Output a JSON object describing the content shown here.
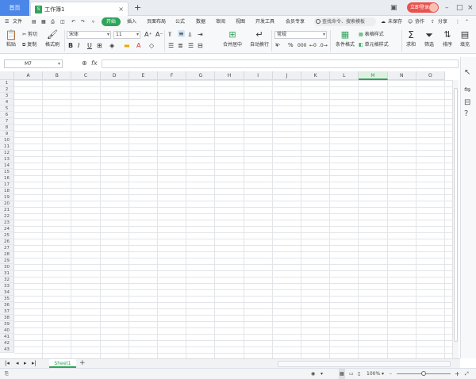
{
  "titlebar": {
    "home_tab": "首页",
    "doc_tab": "工作簿1",
    "doc_icon": "S",
    "close": "×",
    "new_tab": "+",
    "login": "立即登录"
  },
  "menu": {
    "file": "文件",
    "items": [
      "开始",
      "插入",
      "页面布局",
      "公式",
      "数据",
      "审阅",
      "视图",
      "开发工具",
      "会员专享"
    ],
    "active": "开始",
    "search_placeholder": "查找命令、搜索模板",
    "unsaved": "未保存",
    "collab": "协作",
    "share": "分享"
  },
  "ribbon": {
    "paste": "粘贴",
    "cut": "剪切",
    "copy": "复制",
    "format_painter": "格式刷",
    "font": "宋体",
    "size": "11",
    "merge": "合并居中",
    "wrap": "自动换行",
    "number_format": "常规",
    "cond_format": "条件格式",
    "table_style": "表格样式",
    "cell_style": "单元格样式",
    "sum": "求和",
    "filter": "筛选",
    "sort": "排序",
    "fill": "填充"
  },
  "formula": {
    "namebox": "M7",
    "fx": "fx"
  },
  "grid": {
    "columns": [
      "A",
      "B",
      "C",
      "D",
      "E",
      "F",
      "G",
      "H",
      "I",
      "J",
      "K",
      "L",
      "M",
      "N",
      "O"
    ],
    "selected_column": "M",
    "rows": [
      "1",
      "2",
      "3",
      "4",
      "5",
      "6",
      "7",
      "8",
      "9",
      "10",
      "11",
      "12",
      "13",
      "14",
      "15",
      "16",
      "17",
      "18",
      "19",
      "20",
      "21",
      "22",
      "23",
      "24",
      "25",
      "26",
      "27",
      "28",
      "29",
      "30",
      "31",
      "32",
      "33",
      "34",
      "35",
      "36",
      "37",
      "38",
      "39",
      "40",
      "41",
      "42",
      "43"
    ]
  },
  "sheets": {
    "tabs": [
      "Sheet1"
    ],
    "add": "+"
  },
  "status": {
    "zoom": "100%",
    "zoom_minus": "–",
    "zoom_plus": "+"
  },
  "colors": {
    "accent": "#2fa45a",
    "home_tab": "#4a87e8",
    "login": "#e9534f"
  }
}
